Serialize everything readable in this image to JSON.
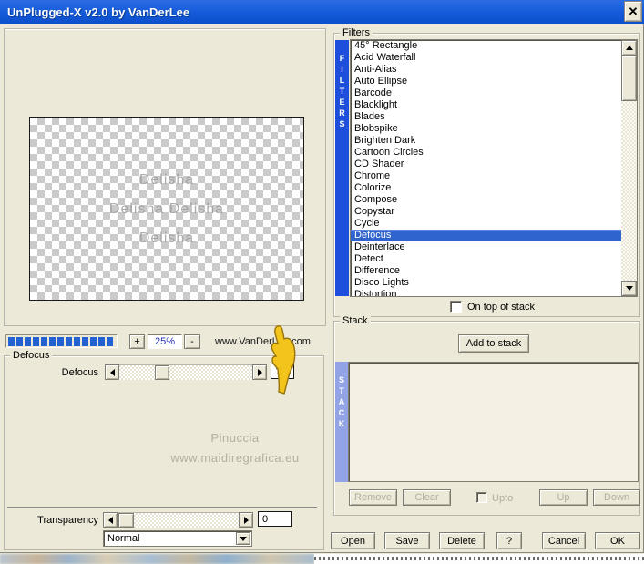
{
  "window": {
    "title": "UnPlugged-X v2.0 by VanDerLee",
    "close_glyph": "✕"
  },
  "preview": {
    "image_watermark_lines": [
      "Delisha",
      "Delisha   Delisha",
      "Delisha"
    ],
    "zoom_in_label": "+",
    "zoom_level": "25%",
    "zoom_out_label": "-",
    "zoom_bar_segments": 13,
    "site_link": "www.VanDerLee.com"
  },
  "defocus_group": {
    "title": "Defocus",
    "slider_label": "Defocus",
    "slider_value": "18",
    "watermark_line1": "Pinuccia",
    "watermark_line2": "www.maidiregrafica.eu",
    "transparency_label": "Transparency",
    "transparency_value": "0",
    "blend_mode": "Normal"
  },
  "filters_group": {
    "title": "Filters",
    "strip": "FILTERS",
    "selected": "Defocus",
    "items": [
      "45° Rectangle",
      "Acid Waterfall",
      "Anti-Alias",
      "Auto Ellipse",
      "Barcode",
      "Blacklight",
      "Blades",
      "Blobspike",
      "Brighten Dark",
      "Cartoon Circles",
      "CD Shader",
      "Chrome",
      "Colorize",
      "Compose",
      "Copystar",
      "Cycle",
      "Defocus",
      "Deinterlace",
      "Detect",
      "Difference",
      "Disco Lights",
      "Distortion"
    ],
    "on_top_label": "On top of stack"
  },
  "stack_group": {
    "title": "Stack",
    "strip": "STACK",
    "add_button": "Add to stack",
    "remove_button": "Remove",
    "clear_button": "Clear",
    "upto_label": "Upto",
    "up_button": "Up",
    "down_button": "Down"
  },
  "footer_buttons": {
    "open": "Open",
    "save": "Save",
    "delete": "Delete",
    "help": "?",
    "cancel": "Cancel",
    "ok": "OK"
  },
  "colors": {
    "titlebar_blue": "#1359d8",
    "selection_blue": "#2f63cd",
    "filters_strip_blue": "#1e4fdc",
    "stack_strip_blue": "#92a4e6",
    "progress_blue": "#2262d3",
    "dialog_bg": "#ece9d8"
  }
}
